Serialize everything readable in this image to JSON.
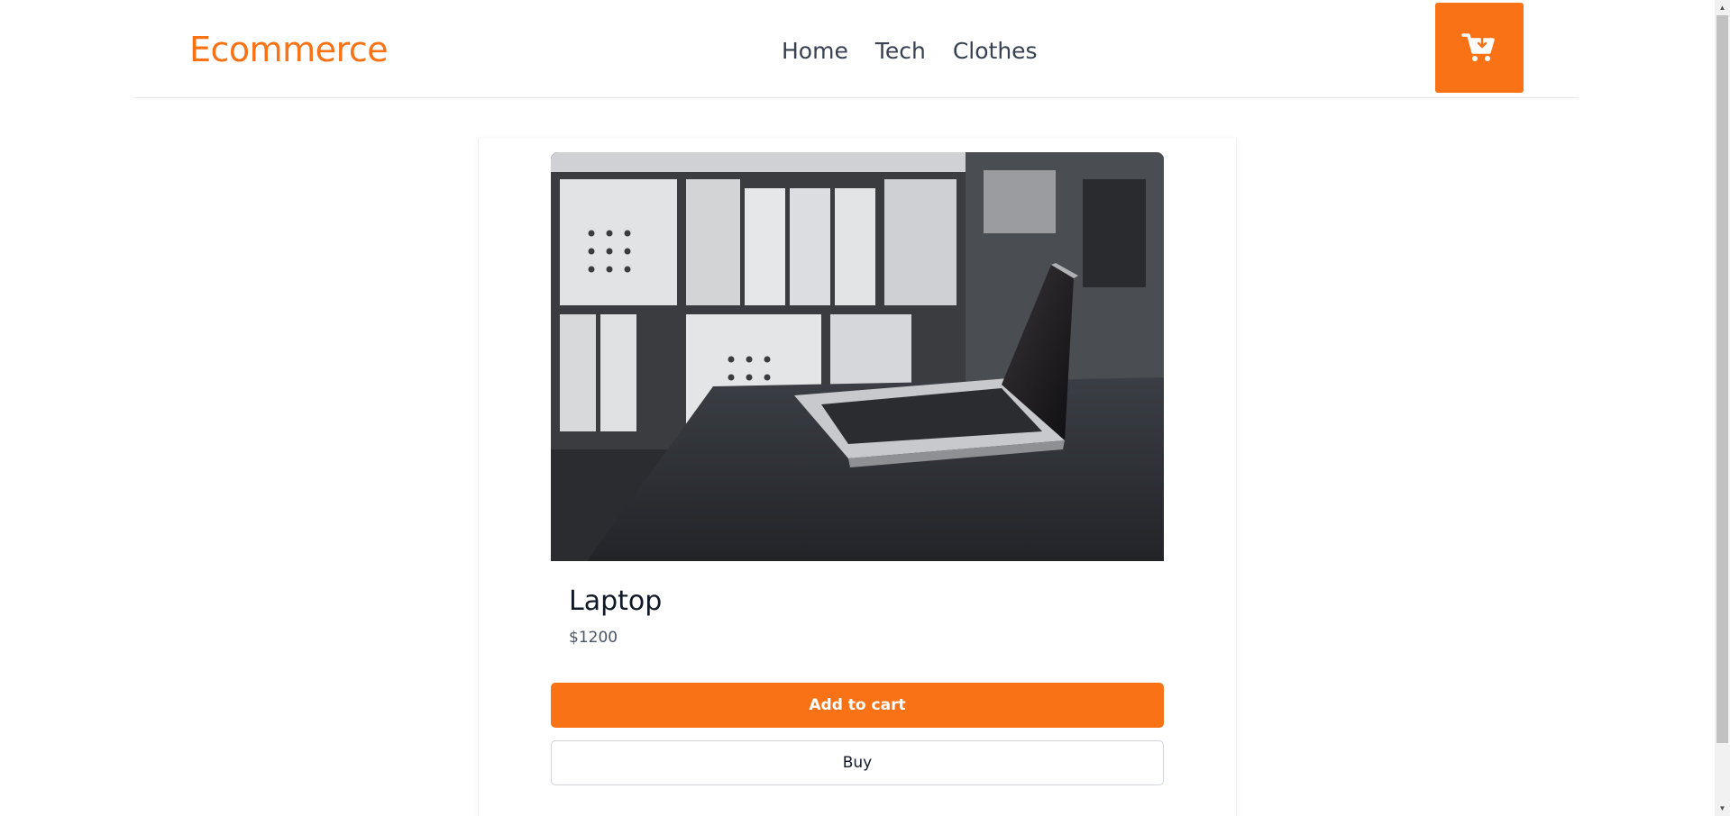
{
  "header": {
    "logo": "Ecommerce",
    "nav": [
      {
        "label": "Home"
      },
      {
        "label": "Tech"
      },
      {
        "label": "Clothes"
      }
    ],
    "cart_icon": "cart-download-icon"
  },
  "product": {
    "name": "Laptop",
    "price": "$1200",
    "image": "laptop-on-desk-photo",
    "add_to_cart_label": "Add to cart",
    "buy_label": "Buy"
  },
  "colors": {
    "accent": "#f97316",
    "nav_text": "#374151",
    "price_text": "#4b5563"
  }
}
